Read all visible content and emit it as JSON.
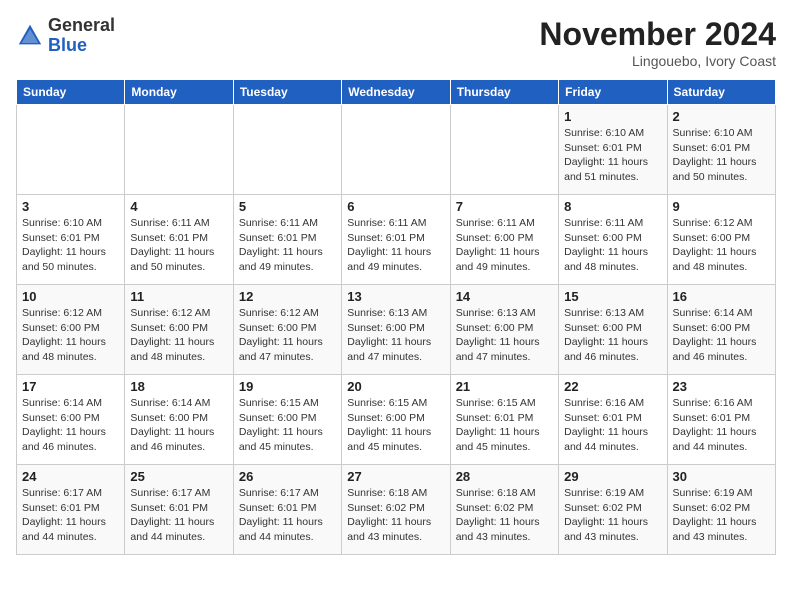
{
  "header": {
    "logo_line1": "General",
    "logo_line2": "Blue",
    "month": "November 2024",
    "location": "Lingouebo, Ivory Coast"
  },
  "weekdays": [
    "Sunday",
    "Monday",
    "Tuesday",
    "Wednesday",
    "Thursday",
    "Friday",
    "Saturday"
  ],
  "weeks": [
    [
      {
        "day": "",
        "info": ""
      },
      {
        "day": "",
        "info": ""
      },
      {
        "day": "",
        "info": ""
      },
      {
        "day": "",
        "info": ""
      },
      {
        "day": "",
        "info": ""
      },
      {
        "day": "1",
        "info": "Sunrise: 6:10 AM\nSunset: 6:01 PM\nDaylight: 11 hours and 51 minutes."
      },
      {
        "day": "2",
        "info": "Sunrise: 6:10 AM\nSunset: 6:01 PM\nDaylight: 11 hours and 50 minutes."
      }
    ],
    [
      {
        "day": "3",
        "info": "Sunrise: 6:10 AM\nSunset: 6:01 PM\nDaylight: 11 hours and 50 minutes."
      },
      {
        "day": "4",
        "info": "Sunrise: 6:11 AM\nSunset: 6:01 PM\nDaylight: 11 hours and 50 minutes."
      },
      {
        "day": "5",
        "info": "Sunrise: 6:11 AM\nSunset: 6:01 PM\nDaylight: 11 hours and 49 minutes."
      },
      {
        "day": "6",
        "info": "Sunrise: 6:11 AM\nSunset: 6:01 PM\nDaylight: 11 hours and 49 minutes."
      },
      {
        "day": "7",
        "info": "Sunrise: 6:11 AM\nSunset: 6:00 PM\nDaylight: 11 hours and 49 minutes."
      },
      {
        "day": "8",
        "info": "Sunrise: 6:11 AM\nSunset: 6:00 PM\nDaylight: 11 hours and 48 minutes."
      },
      {
        "day": "9",
        "info": "Sunrise: 6:12 AM\nSunset: 6:00 PM\nDaylight: 11 hours and 48 minutes."
      }
    ],
    [
      {
        "day": "10",
        "info": "Sunrise: 6:12 AM\nSunset: 6:00 PM\nDaylight: 11 hours and 48 minutes."
      },
      {
        "day": "11",
        "info": "Sunrise: 6:12 AM\nSunset: 6:00 PM\nDaylight: 11 hours and 48 minutes."
      },
      {
        "day": "12",
        "info": "Sunrise: 6:12 AM\nSunset: 6:00 PM\nDaylight: 11 hours and 47 minutes."
      },
      {
        "day": "13",
        "info": "Sunrise: 6:13 AM\nSunset: 6:00 PM\nDaylight: 11 hours and 47 minutes."
      },
      {
        "day": "14",
        "info": "Sunrise: 6:13 AM\nSunset: 6:00 PM\nDaylight: 11 hours and 47 minutes."
      },
      {
        "day": "15",
        "info": "Sunrise: 6:13 AM\nSunset: 6:00 PM\nDaylight: 11 hours and 46 minutes."
      },
      {
        "day": "16",
        "info": "Sunrise: 6:14 AM\nSunset: 6:00 PM\nDaylight: 11 hours and 46 minutes."
      }
    ],
    [
      {
        "day": "17",
        "info": "Sunrise: 6:14 AM\nSunset: 6:00 PM\nDaylight: 11 hours and 46 minutes."
      },
      {
        "day": "18",
        "info": "Sunrise: 6:14 AM\nSunset: 6:00 PM\nDaylight: 11 hours and 46 minutes."
      },
      {
        "day": "19",
        "info": "Sunrise: 6:15 AM\nSunset: 6:00 PM\nDaylight: 11 hours and 45 minutes."
      },
      {
        "day": "20",
        "info": "Sunrise: 6:15 AM\nSunset: 6:00 PM\nDaylight: 11 hours and 45 minutes."
      },
      {
        "day": "21",
        "info": "Sunrise: 6:15 AM\nSunset: 6:01 PM\nDaylight: 11 hours and 45 minutes."
      },
      {
        "day": "22",
        "info": "Sunrise: 6:16 AM\nSunset: 6:01 PM\nDaylight: 11 hours and 44 minutes."
      },
      {
        "day": "23",
        "info": "Sunrise: 6:16 AM\nSunset: 6:01 PM\nDaylight: 11 hours and 44 minutes."
      }
    ],
    [
      {
        "day": "24",
        "info": "Sunrise: 6:17 AM\nSunset: 6:01 PM\nDaylight: 11 hours and 44 minutes."
      },
      {
        "day": "25",
        "info": "Sunrise: 6:17 AM\nSunset: 6:01 PM\nDaylight: 11 hours and 44 minutes."
      },
      {
        "day": "26",
        "info": "Sunrise: 6:17 AM\nSunset: 6:01 PM\nDaylight: 11 hours and 44 minutes."
      },
      {
        "day": "27",
        "info": "Sunrise: 6:18 AM\nSunset: 6:02 PM\nDaylight: 11 hours and 43 minutes."
      },
      {
        "day": "28",
        "info": "Sunrise: 6:18 AM\nSunset: 6:02 PM\nDaylight: 11 hours and 43 minutes."
      },
      {
        "day": "29",
        "info": "Sunrise: 6:19 AM\nSunset: 6:02 PM\nDaylight: 11 hours and 43 minutes."
      },
      {
        "day": "30",
        "info": "Sunrise: 6:19 AM\nSunset: 6:02 PM\nDaylight: 11 hours and 43 minutes."
      }
    ]
  ]
}
